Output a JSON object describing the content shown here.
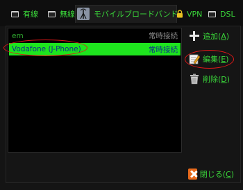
{
  "tabs": [
    {
      "label": "有線",
      "icon": "wired-icon"
    },
    {
      "label": "無線",
      "icon": "wireless-icon"
    },
    {
      "label": "モバイルブロードバンド",
      "icon": "antenna-icon",
      "active": true
    },
    {
      "label": "VPN",
      "icon": "lock-icon"
    },
    {
      "label": "DSL",
      "icon": "dsl-icon"
    }
  ],
  "list": {
    "header": {
      "name": "em",
      "status": "常時接続"
    },
    "rows": [
      {
        "name": "Vodafone (J-Phone)",
        "status": "常時接続",
        "selected": true
      }
    ]
  },
  "buttons": {
    "add": {
      "label": "追加",
      "accel": "A"
    },
    "edit": {
      "label": "編集",
      "accel": "E"
    },
    "delete": {
      "label": "削除",
      "accel": "D"
    },
    "close": {
      "label": "閉じる",
      "accel": "C"
    }
  },
  "colors": {
    "text": "#3ad73a",
    "selection": "#1ee51e",
    "annotation": "#e01818",
    "close_icon": "#e86a1c"
  }
}
